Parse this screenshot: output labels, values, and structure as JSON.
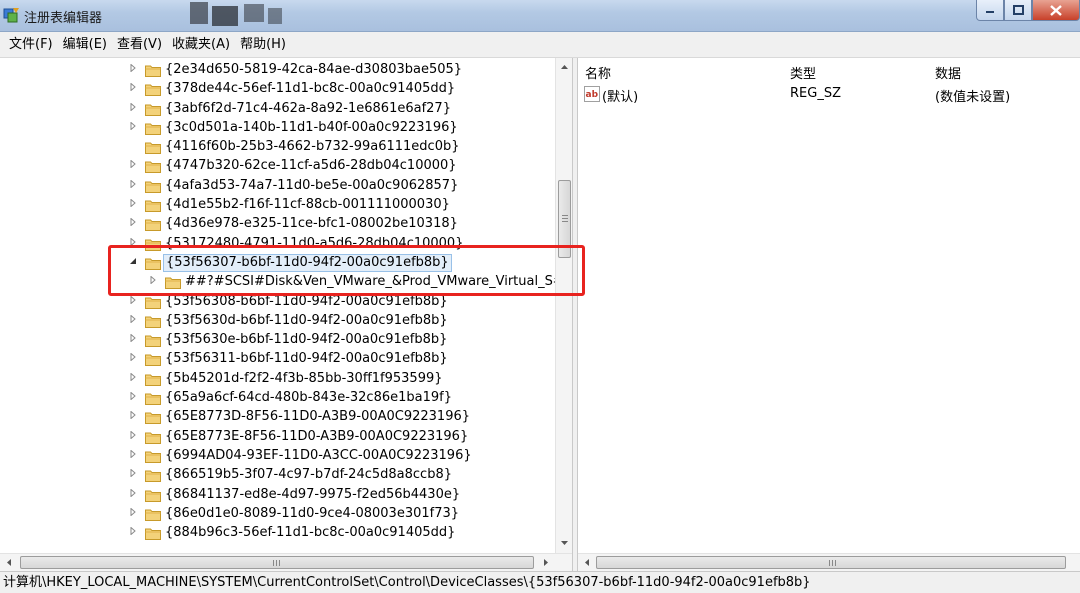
{
  "window": {
    "title": "注册表编辑器",
    "app_icon": "regedit-icon",
    "controls": {
      "minimize": "minimize-icon",
      "maximize": "maximize-icon",
      "close": "close-icon"
    }
  },
  "menu": [
    "文件(F)",
    "编辑(E)",
    "查看(V)",
    "收藏夹(A)",
    "帮助(H)"
  ],
  "tree": {
    "nodes": [
      {
        "label": "{2e34d650-5819-42ca-84ae-d30803bae505}",
        "expander": "collapsed",
        "level": 0
      },
      {
        "label": "{378de44c-56ef-11d1-bc8c-00a0c91405dd}",
        "expander": "collapsed",
        "level": 0
      },
      {
        "label": "{3abf6f2d-71c4-462a-8a92-1e6861e6af27}",
        "expander": "collapsed",
        "level": 0
      },
      {
        "label": "{3c0d501a-140b-11d1-b40f-00a0c9223196}",
        "expander": "collapsed",
        "level": 0
      },
      {
        "label": "{4116f60b-25b3-4662-b732-99a6111edc0b}",
        "expander": "none",
        "level": 0
      },
      {
        "label": "{4747b320-62ce-11cf-a5d6-28db04c10000}",
        "expander": "collapsed",
        "level": 0
      },
      {
        "label": "{4afa3d53-74a7-11d0-be5e-00a0c9062857}",
        "expander": "collapsed",
        "level": 0
      },
      {
        "label": "{4d1e55b2-f16f-11cf-88cb-001111000030}",
        "expander": "collapsed",
        "level": 0
      },
      {
        "label": "{4d36e978-e325-11ce-bfc1-08002be10318}",
        "expander": "collapsed",
        "level": 0
      },
      {
        "label": "{53172480-4791-11d0-a5d6-28db04c10000}",
        "expander": "collapsed",
        "level": 0
      },
      {
        "label": "{53f56307-b6bf-11d0-94f2-00a0c91efb8b}",
        "expander": "expanded",
        "level": 0,
        "selected": true
      },
      {
        "label": "##?#SCSI#Disk&Ven_VMware_&Prod_VMware_Virtual_S#",
        "expander": "collapsed",
        "level": 1
      },
      {
        "label": "{53f56308-b6bf-11d0-94f2-00a0c91efb8b}",
        "expander": "collapsed",
        "level": 0
      },
      {
        "label": "{53f5630d-b6bf-11d0-94f2-00a0c91efb8b}",
        "expander": "collapsed",
        "level": 0
      },
      {
        "label": "{53f5630e-b6bf-11d0-94f2-00a0c91efb8b}",
        "expander": "collapsed",
        "level": 0
      },
      {
        "label": "{53f56311-b6bf-11d0-94f2-00a0c91efb8b}",
        "expander": "collapsed",
        "level": 0
      },
      {
        "label": "{5b45201d-f2f2-4f3b-85bb-30ff1f953599}",
        "expander": "collapsed",
        "level": 0
      },
      {
        "label": "{65a9a6cf-64cd-480b-843e-32c86e1ba19f}",
        "expander": "collapsed",
        "level": 0
      },
      {
        "label": "{65E8773D-8F56-11D0-A3B9-00A0C9223196}",
        "expander": "collapsed",
        "level": 0
      },
      {
        "label": "{65E8773E-8F56-11D0-A3B9-00A0C9223196}",
        "expander": "collapsed",
        "level": 0
      },
      {
        "label": "{6994AD04-93EF-11D0-A3CC-00A0C9223196}",
        "expander": "collapsed",
        "level": 0
      },
      {
        "label": "{866519b5-3f07-4c97-b7df-24c5d8a8ccb8}",
        "expander": "collapsed",
        "level": 0
      },
      {
        "label": "{86841137-ed8e-4d97-9975-f2ed56b4430e}",
        "expander": "collapsed",
        "level": 0
      },
      {
        "label": "{86e0d1e0-8089-11d0-9ce4-08003e301f73}",
        "expander": "collapsed",
        "level": 0
      },
      {
        "label": "{884b96c3-56ef-11d1-bc8c-00a0c91405dd}",
        "expander": "collapsed",
        "level": 0
      }
    ]
  },
  "values_list": {
    "columns": {
      "name": "名称",
      "type": "类型",
      "data": "数据"
    },
    "rows": [
      {
        "name": "(默认)",
        "type": "REG_SZ",
        "data": "(数值未设置)",
        "icon": "ab-string-icon"
      }
    ]
  },
  "status_bar": {
    "path": "计算机\\HKEY_LOCAL_MACHINE\\SYSTEM\\CurrentControlSet\\Control\\DeviceClasses\\{53f56307-b6bf-11d0-94f2-00a0c91efb8b}"
  },
  "annotation": {
    "color": "#e8231f"
  }
}
